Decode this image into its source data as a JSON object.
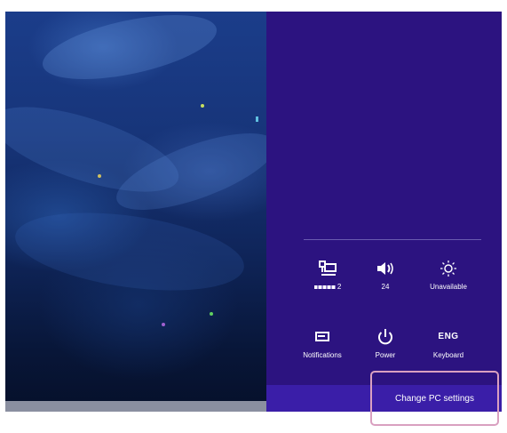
{
  "charms": {
    "network": {
      "icon": "network-icon",
      "label": "2"
    },
    "volume": {
      "icon": "speaker-icon",
      "label": "24"
    },
    "brightness": {
      "icon": "brightness-icon",
      "label": "Unavailable"
    },
    "notifications": {
      "icon": "notifications-icon",
      "label": "Notifications"
    },
    "power": {
      "icon": "power-icon",
      "label": "Power"
    },
    "keyboard": {
      "glyph": "ENG",
      "label": "Keyboard"
    },
    "change_pc_settings": "Change PC settings"
  },
  "colors": {
    "charms_background": "#2c1380",
    "settings_bar": "#3a1ea8",
    "highlight_border": "#d9a0c0"
  }
}
